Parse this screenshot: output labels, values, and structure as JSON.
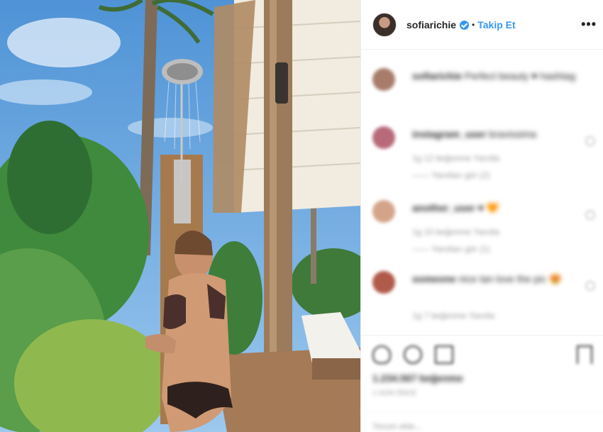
{
  "post": {
    "username": "sofiarichie",
    "separator": "•",
    "follow_label": "Takip Et",
    "more_label": "•••",
    "icon_verified": "verified-badge-icon",
    "colors": {
      "accent": "#3897f0",
      "text": "#262626",
      "muted": "#999999"
    }
  },
  "comments": [
    {
      "user": "sofiarichie",
      "text": "Perfect beauty ♥ hashtag",
      "avatar_color": "#a87c6b"
    },
    {
      "user": "instagram_user",
      "text": "bravissima",
      "meta": "1g  12 beğenme  Yanıtla",
      "replies": "—— Yanıtları gör (2)",
      "avatar_color": "#b86a7a"
    },
    {
      "user": "another_user",
      "text": "♥ 🧡",
      "meta": "1g  10 beğenme  Yanıtla",
      "replies": "—— Yanıtları gör (1)",
      "avatar_color": "#d4a48a"
    },
    {
      "user": "someone",
      "text": "nice tan love the pic 😍",
      "meta": "1g  7 beğenme  Yanıtla",
      "avatar_color": "#b05a4a"
    }
  ],
  "actions": {
    "likes": "1.234.567 beğenme",
    "time": "1 GÜN ÖNCE",
    "add_comment": "Yorum ekle..."
  }
}
